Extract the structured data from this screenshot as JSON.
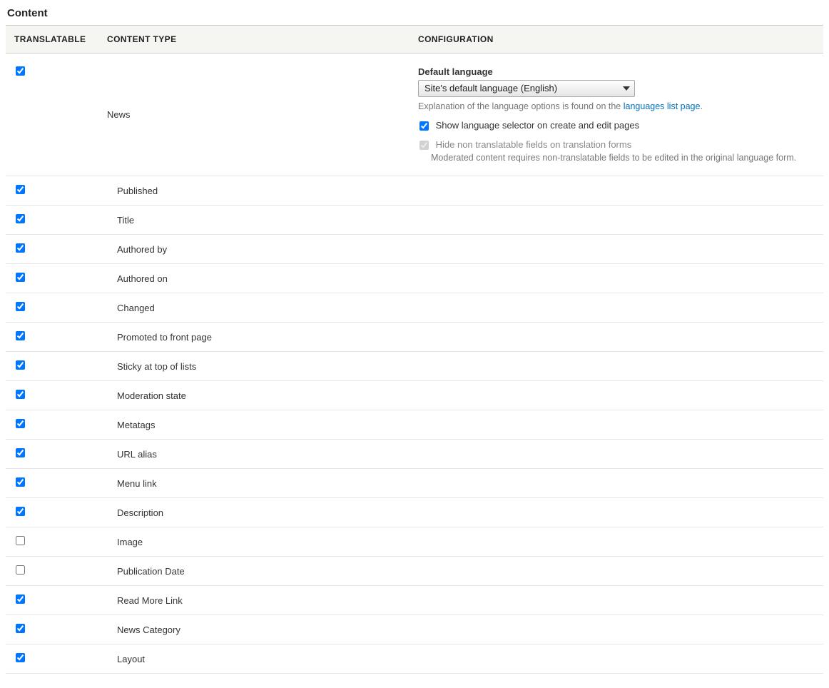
{
  "section_title": "Content",
  "headers": {
    "translatable": "Translatable",
    "content_type": "Content Type",
    "configuration": "Configuration"
  },
  "config_row": {
    "checked": true,
    "name": "News",
    "default_language_label": "Default language",
    "default_language_value": "Site's default language (English)",
    "explanation_pre": "Explanation of the language options is found on the ",
    "explanation_link": "languages list page",
    "explanation_post": ".",
    "show_selector_checked": true,
    "show_selector_label": "Show language selector on create and edit pages",
    "hide_fields_checked": true,
    "hide_fields_label": "Hide non translatable fields on translation forms",
    "moderated_note": "Moderated content requires non-translatable fields to be edited in the original language form."
  },
  "fields": [
    {
      "label": "Published",
      "checked": true
    },
    {
      "label": "Title",
      "checked": true
    },
    {
      "label": "Authored by",
      "checked": true
    },
    {
      "label": "Authored on",
      "checked": true
    },
    {
      "label": "Changed",
      "checked": true
    },
    {
      "label": "Promoted to front page",
      "checked": true
    },
    {
      "label": "Sticky at top of lists",
      "checked": true
    },
    {
      "label": "Moderation state",
      "checked": true
    },
    {
      "label": "Metatags",
      "checked": true
    },
    {
      "label": "URL alias",
      "checked": true
    },
    {
      "label": "Menu link",
      "checked": true
    },
    {
      "label": "Description",
      "checked": true
    },
    {
      "label": "Image",
      "checked": false
    },
    {
      "label": "Publication Date",
      "checked": false
    },
    {
      "label": "Read More Link",
      "checked": true
    },
    {
      "label": "News Category",
      "checked": true
    },
    {
      "label": "Layout",
      "checked": true
    }
  ]
}
